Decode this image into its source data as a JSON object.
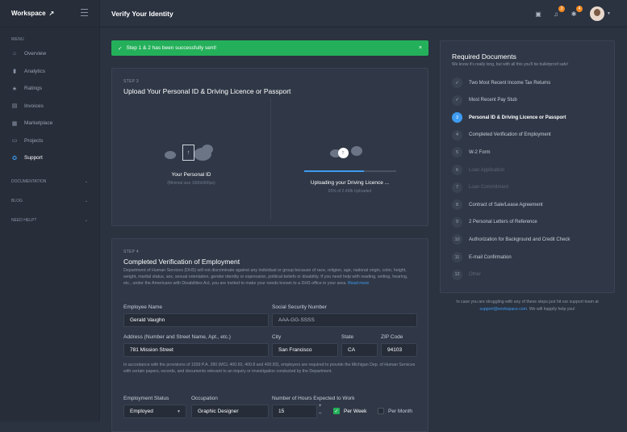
{
  "sidebar": {
    "brand": "Workspace",
    "menu_label": "MENU",
    "items": [
      {
        "label": "Overview",
        "icon": "home-icon",
        "glyph": "⌂"
      },
      {
        "label": "Analytics",
        "icon": "bar-chart-icon",
        "glyph": "▮"
      },
      {
        "label": "Ratings",
        "icon": "star-icon",
        "glyph": "★"
      },
      {
        "label": "Invoices",
        "icon": "invoice-icon",
        "glyph": "▤"
      },
      {
        "label": "Marketplace",
        "icon": "store-icon",
        "glyph": "▦"
      },
      {
        "label": "Projects",
        "icon": "chat-icon",
        "glyph": "▭"
      },
      {
        "label": "Support",
        "icon": "support-icon",
        "glyph": "✪"
      }
    ],
    "sections": [
      "DOCUMENTATION",
      "BLOG",
      "NEED HELP?"
    ]
  },
  "header": {
    "title": "Verify Your Identity",
    "badge1": "3",
    "badge2": "4"
  },
  "alert": {
    "text": "Step 1 & 2 has been successfully sent!",
    "close": "×"
  },
  "step3": {
    "step": "STEP 3",
    "title": "Upload Your Personal ID & Driving Licence or Passport",
    "left_label": "Your Personal ID",
    "left_sub": "(Minimal size 1600x900px)",
    "right_label": "Uploading your Driving Licence ...",
    "right_sub": "65% of 2.4Mb Uploaded",
    "progress": 0.65
  },
  "step4": {
    "step": "STEP 4",
    "title": "Completed Verification of Employment",
    "desc": "Department of Human Services (DHS) will not discriminate against any individual or group because of race, religion, age, national origin, color, height, weight, marital status, sex, sexual orientation, gender identity or expression, political beliefs or disability. If you need help with reading, writing, hearing, etc., under the Americans with Disabilities Act, you are invited to make your needs known to a DHS office in your area.",
    "read_more": "Read more",
    "employee_name_label": "Employee Name",
    "employee_name": "Gerald Vaughn",
    "ssn_label": "Social Security Number",
    "ssn": "AAA-GG-SSSS",
    "address_label": "Address (Number and Street Name, Apt., etc.)",
    "address": "781 Mission Street",
    "city_label": "City",
    "city": "San Francisco",
    "state_label": "State",
    "state": "CA",
    "zip_label": "ZIP Code",
    "zip": "94103",
    "legal": "In accordance with the provisions of 1939 P.A. 280 (MCL 400.60, 400.8 and 400.83), employers are required to provide the Michigan Dep. of Human Services with certain papers, records, and documents relevant to an inquiry or investigation conducted by the Department.",
    "employment_status_label": "Employment Status",
    "employment_status": "Employed",
    "occupation_label": "Occupation",
    "occupation": "Graphic Designer",
    "hours_label": "Number of Hours Expected to Work",
    "hours": "15",
    "per_week": "Per Week",
    "per_month": "Per Month"
  },
  "required": {
    "title": "Required Documents",
    "subtitle": "We know it's really long, but with all this you'll be bulletproof safe!",
    "items": [
      {
        "num": "✓",
        "label": "Two Most Recent Income Tax Returns",
        "state": "done"
      },
      {
        "num": "✓",
        "label": "Most Recent Pay Stub",
        "state": "done"
      },
      {
        "num": "3",
        "label": "Personal ID & Driving Licence or Passport",
        "state": "current"
      },
      {
        "num": "4",
        "label": "Completed Verification of Employment",
        "state": "todo"
      },
      {
        "num": "5",
        "label": "W-2 Form",
        "state": "todo"
      },
      {
        "num": "6",
        "label": "Loan Application",
        "state": "disabled"
      },
      {
        "num": "7",
        "label": "Loan Commitment",
        "state": "disabled"
      },
      {
        "num": "8",
        "label": "Contract of Sale/Lease Agreement",
        "state": "todo"
      },
      {
        "num": "9",
        "label": "2 Personal Letters of Reference",
        "state": "todo"
      },
      {
        "num": "10",
        "label": "Authorization for Background and Credit Check",
        "state": "todo"
      },
      {
        "num": "11",
        "label": "E-mail Confirmation",
        "state": "todo"
      },
      {
        "num": "12",
        "label": "Other",
        "state": "disabled"
      }
    ],
    "support_text": "In case you are struggling with any of these steps just hit our support team at",
    "support_email": "support@workspace.com",
    "support_tail": ". We will happily help you!"
  }
}
